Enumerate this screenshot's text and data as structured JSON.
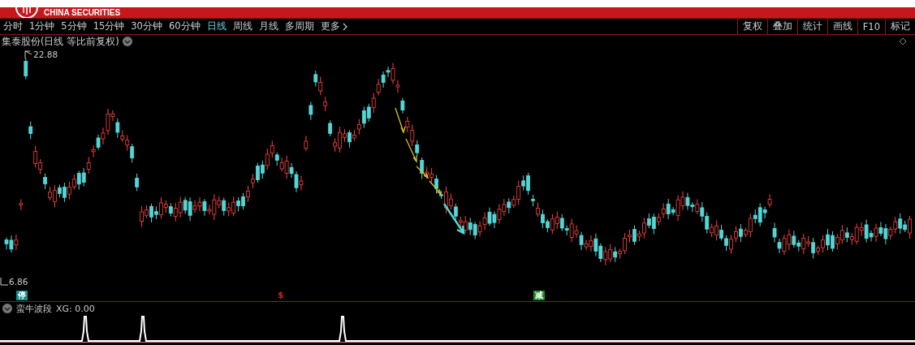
{
  "header": {
    "logo_text": "CHINA SECURITIES"
  },
  "periods": [
    {
      "label": "分时",
      "selected": false
    },
    {
      "label": "1分钟",
      "selected": false
    },
    {
      "label": "5分钟",
      "selected": false
    },
    {
      "label": "15分钟",
      "selected": false
    },
    {
      "label": "30分钟",
      "selected": false
    },
    {
      "label": "60分钟",
      "selected": false
    },
    {
      "label": "日线",
      "selected": true
    },
    {
      "label": "周线",
      "selected": false
    },
    {
      "label": "月线",
      "selected": false
    },
    {
      "label": "多周期",
      "selected": false
    },
    {
      "label": "更多",
      "selected": false
    }
  ],
  "tools": [
    "复权",
    "叠加",
    "统计",
    "画线",
    "F10",
    "标记"
  ],
  "chart": {
    "title": "集泰股份(日线 等比前复权)",
    "price_high": "22.88",
    "price_low": "6.86"
  },
  "signals": [
    {
      "label": "停",
      "color": "#178c8c"
    },
    {
      "label": "$",
      "color": "#e02020"
    },
    {
      "label": "减",
      "color": "#1f8a1f"
    }
  ],
  "indicator": {
    "name": "蛮牛波段",
    "reading": "XG: 0.00"
  }
}
